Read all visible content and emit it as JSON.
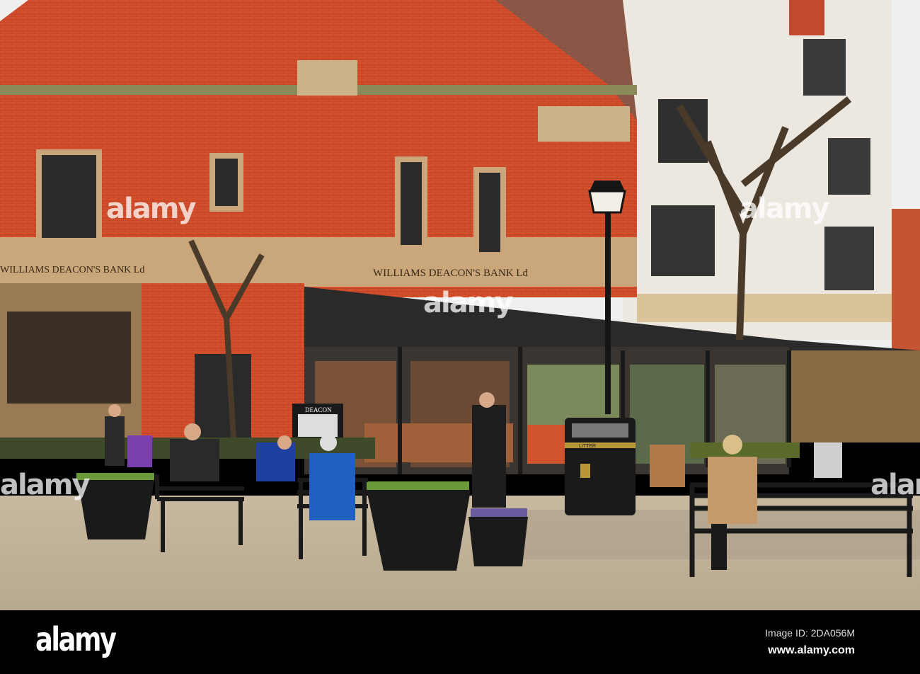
{
  "scene": {
    "bank_sign_main": "WILLIAMS DEACON'S BANK Ld",
    "bank_sign_left": "WILLIAMS DEACON'S BANK Ld",
    "menu_board": "DEACON",
    "bin_label": "LITTER"
  },
  "watermark": {
    "text": "alamy"
  },
  "footer": {
    "logo": "alamy",
    "image_id": "Image ID: 2DA056M",
    "url": "www.alamy.com"
  }
}
